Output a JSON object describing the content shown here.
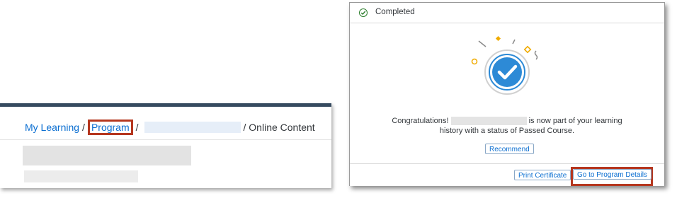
{
  "breadcrumb": {
    "my_learning": "My Learning",
    "separator": "/",
    "program": "Program",
    "online_content": "/ Online Content"
  },
  "dialog": {
    "title": "Completed",
    "message_part1": "Congratulations!",
    "message_part2": "is now part of your learning",
    "message_part3": "history with a status of Passed Course.",
    "recommend_label": "Recommend",
    "print_certificate_label": "Print Certificate",
    "go_to_program_label": "Go to Program Details"
  },
  "colors": {
    "link": "#0a6ed1",
    "highlight": "#b5371f",
    "header_bar": "#354a5f",
    "success_check": "#2b7d2b",
    "illustration_blue": "#2d8ad6"
  },
  "icons": {
    "status": "check-circle-icon",
    "illustration": "success-checkmark-illustration"
  }
}
